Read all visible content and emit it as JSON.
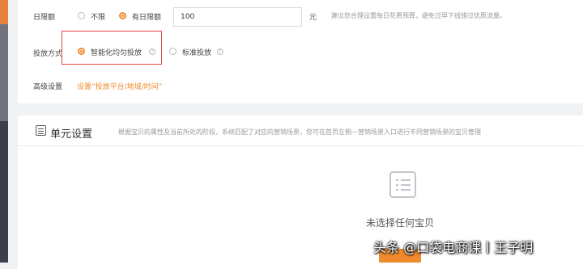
{
  "budget": {
    "label": "日限额",
    "option_unlimited": "不限",
    "option_daily": "有日限额",
    "input_value": "100",
    "unit": "元",
    "tip": "建议您合理设置每日花费预算，避免过早下线错过优质流量。"
  },
  "delivery": {
    "label": "投放方式",
    "option_smart": "智能化均匀投放",
    "option_standard": "标准投放"
  },
  "advanced": {
    "label": "高级设置",
    "link": "设置“投放平台/地域/时间”"
  },
  "unit_section": {
    "title": "单元设置",
    "description": "根据宝贝的属性及当前所处的阶段，系统匹配了对应的营销场景，您可在首页左侧—营销场景入口进行不同营销场景的宝贝管理",
    "empty_text": "未选择任何宝贝"
  },
  "watermark": "头条 @口袋电商课丨王子明",
  "colors": {
    "accent": "#f08a2c",
    "highlight_box": "#e0483d"
  },
  "icons": {
    "help": "question-circle-icon",
    "section": "list-document-icon",
    "empty": "list-document-icon"
  }
}
